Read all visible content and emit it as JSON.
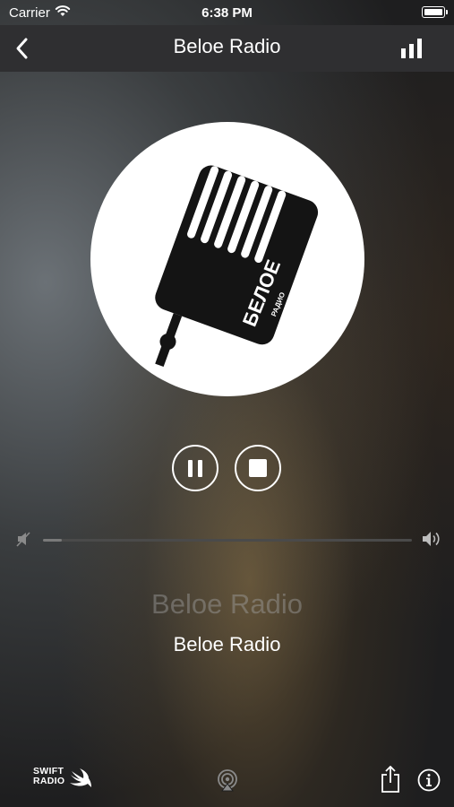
{
  "status_bar": {
    "carrier": "Carrier",
    "time": "6:38 PM"
  },
  "nav": {
    "title": "Beloe Radio",
    "back_icon": "chevron-left-icon",
    "menu_icon": "bar-chart-icon"
  },
  "artwork": {
    "logo_text": "БЕЛОЕ",
    "logo_subtext": "РАДИО"
  },
  "controls": {
    "pause_icon": "pause-icon",
    "stop_icon": "stop-icon"
  },
  "volume": {
    "level_fraction": 0.05
  },
  "now_playing": {
    "song": "Beloe Radio",
    "artist": "Beloe Radio"
  },
  "footer": {
    "logo_line1": "SWIFT",
    "logo_line2": "RADIO",
    "airplay_icon": "airplay-icon",
    "share_icon": "share-icon",
    "info_icon": "info-icon"
  },
  "colors": {
    "nav_bg": "#2f2f31",
    "text": "#ffffff",
    "song_dim": "#a0a0a0"
  }
}
